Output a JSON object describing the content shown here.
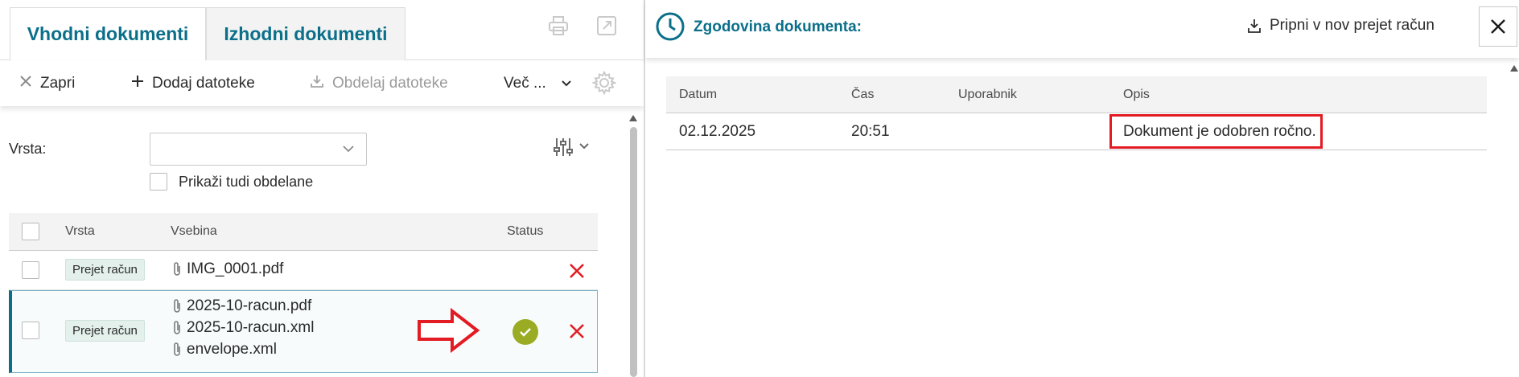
{
  "left_panel": {
    "tabs": [
      {
        "label": "Vhodni dokumenti",
        "active": true
      },
      {
        "label": "Izhodni dokumenti",
        "active": false
      }
    ],
    "toolbar": {
      "close_label": "Zapri",
      "add_files_label": "Dodaj datoteke",
      "process_files_label": "Obdelaj datoteke",
      "more_label": "Več ..."
    },
    "filter": {
      "type_label": "Vrsta:",
      "type_value": "",
      "show_processed_label": "Prikaži tudi obdelane"
    },
    "grid": {
      "columns": [
        "Vrsta",
        "Vsebina",
        "Status"
      ],
      "rows": [
        {
          "type": "Prejet račun",
          "files": [
            "IMG_0001.pdf"
          ],
          "status": "",
          "selected": false
        },
        {
          "type": "Prejet račun",
          "files": [
            "2025-10-racun.pdf",
            "2025-10-racun.xml",
            "envelope.xml"
          ],
          "status": "approved",
          "selected": true
        }
      ]
    },
    "icons": [
      "print-icon",
      "open-external-icon",
      "close-x-icon",
      "plus-icon",
      "download-icon",
      "chevron-down-icon",
      "gear-icon",
      "filter-sliders-icon",
      "paperclip-icon",
      "delete-x-icon",
      "check-circle-icon",
      "red-arrow-annotation"
    ]
  },
  "right_panel": {
    "title": "Zgodovina dokumenta:",
    "attach_button_label": "Pripni v nov prejet račun",
    "history": {
      "columns": [
        "Datum",
        "Čas",
        "Uporabnik",
        "Opis"
      ],
      "rows": [
        {
          "date": "02.12.2025",
          "time": "20:51",
          "user": "",
          "description": "Dokument je odobren ročno."
        }
      ]
    },
    "icons": [
      "clock-icon",
      "download-attach-icon",
      "close-icon"
    ]
  },
  "colors": {
    "accent": "#0b6f8a",
    "delete_red": "#e31b23",
    "approved_green": "#9aab24",
    "annotation_red": "#e31b23",
    "badge_bg": "#e3f0ec"
  }
}
